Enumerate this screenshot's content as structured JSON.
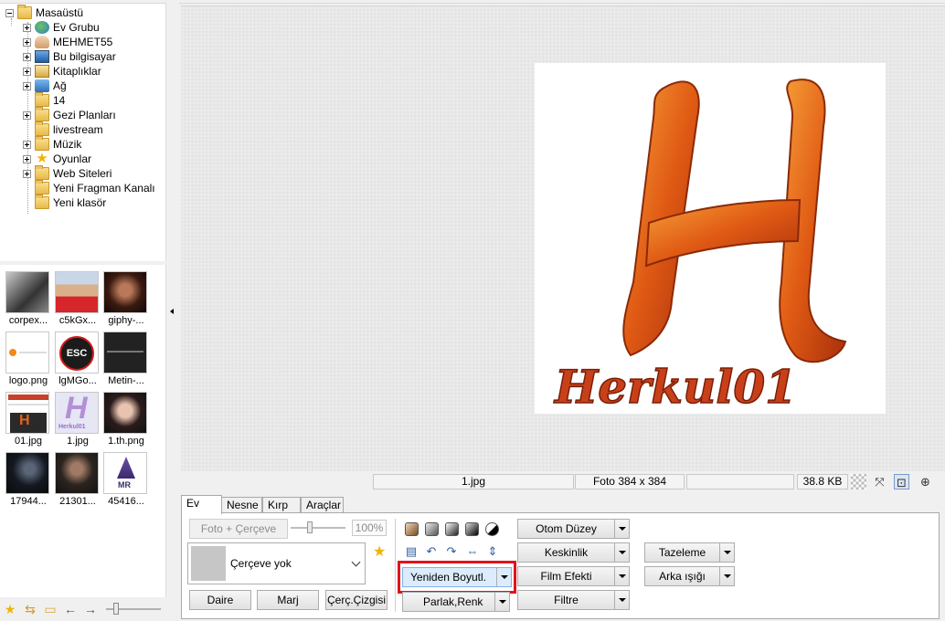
{
  "tree": {
    "items": [
      {
        "label": "Masaüstü",
        "icon": "folder-icon"
      },
      {
        "label": "Ev Grubu",
        "icon": "homegroup-icon"
      },
      {
        "label": "MEHMET55",
        "icon": "user-folder-icon"
      },
      {
        "label": "Bu bilgisayar",
        "icon": "computer-icon"
      },
      {
        "label": "Kitaplıklar",
        "icon": "libraries-icon"
      },
      {
        "label": "Ağ",
        "icon": "network-icon"
      },
      {
        "label": "14",
        "icon": "folder-icon"
      },
      {
        "label": "Gezi Planları",
        "icon": "folder-icon"
      },
      {
        "label": "livestream",
        "icon": "folder-icon"
      },
      {
        "label": "Müzik",
        "icon": "folder-icon"
      },
      {
        "label": "Oyunlar",
        "icon": "star-icon"
      },
      {
        "label": "Web Siteleri",
        "icon": "folder-icon"
      },
      {
        "label": "Yeni Fragman Kanalı",
        "icon": "folder-icon"
      },
      {
        "label": "Yeni klasör",
        "icon": "folder-icon"
      }
    ]
  },
  "thumbnails": [
    {
      "caption": "corpex..."
    },
    {
      "caption": "c5kGx..."
    },
    {
      "caption": "giphy-..."
    },
    {
      "caption": "logo.png"
    },
    {
      "caption": "lgMGo..."
    },
    {
      "caption": "Metin-..."
    },
    {
      "caption": "01.jpg"
    },
    {
      "caption": "1.jpg"
    },
    {
      "caption": "1.th.png"
    },
    {
      "caption": "17944..."
    },
    {
      "caption": "21301..."
    },
    {
      "caption": "45416..."
    }
  ],
  "thumb_text": {
    "esc": "ESC",
    "h": "H",
    "herkul_small": "Herkul01",
    "mr": "MR"
  },
  "viewer": {
    "logo_letter": "H",
    "logo_text": "Herkul01"
  },
  "status": {
    "filename": "1.jpg",
    "dimensions": "Foto 384 x 384",
    "filesize": "38.8 KB"
  },
  "tabs": [
    "Ev",
    "Nesne",
    "Kırp",
    "Araçlar"
  ],
  "ribbon": {
    "photo_frame": "Foto + Çerçeve",
    "zoom_pct": "100%",
    "frame_select": "Çerçeve yok",
    "daire": "Daire",
    "marj": "Marj",
    "cerc_cizgisi": "Çerç.Çizgisi",
    "resize": "Yeniden Boyutl.",
    "bright_color": "Parlak,Renk",
    "auto_level": "Otom Düzey",
    "sharpness": "Keskinlik",
    "film_effect": "Film Efekti",
    "filter": "Filtre",
    "refresh": "Tazeleme",
    "backlight": "Arka ışığı"
  },
  "colors": {
    "highlight": "#e0131e",
    "logo_orange": "#e8611a"
  }
}
